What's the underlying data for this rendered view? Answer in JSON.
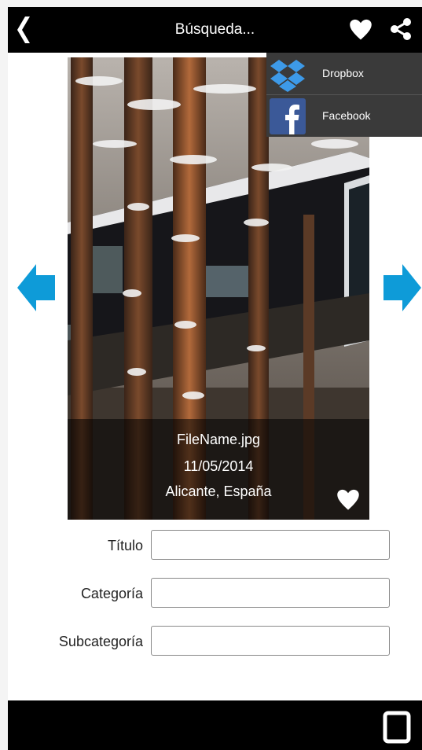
{
  "header": {
    "title": "Búsqueda...",
    "back_icon": "chevron-left-icon",
    "favorite_icon": "heart-icon",
    "share_icon": "share-icon"
  },
  "share_menu": {
    "items": [
      {
        "label": "Dropbox",
        "icon": "dropbox-icon",
        "color": "#3d9ae8"
      },
      {
        "label": "Facebook",
        "icon": "facebook-icon",
        "color": "#3b5998"
      }
    ]
  },
  "photo": {
    "file_name": "FileName.jpg",
    "date": "11/05/2014",
    "location": "Alicante, España",
    "favorite_icon": "heart-icon"
  },
  "navigation": {
    "prev_icon": "arrow-left-icon",
    "next_icon": "arrow-right-icon",
    "arrow_color": "#0e9bd8"
  },
  "form": {
    "titulo_label": "Título",
    "titulo_value": "",
    "categoria_label": "Categoría",
    "categoria_value": "",
    "subcategoria_label": "Subcategoría",
    "subcategoria_value": ""
  },
  "bottom_bar": {
    "recent_apps_icon": "recent-apps-icon"
  }
}
